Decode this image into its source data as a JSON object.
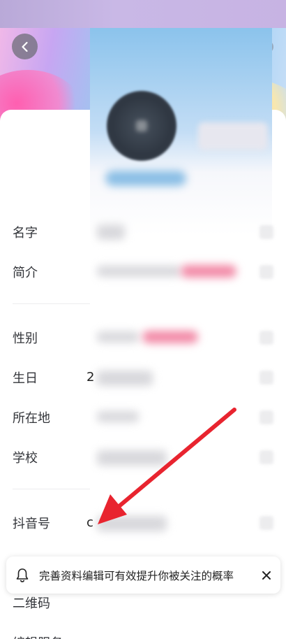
{
  "nav": {
    "back_icon": "chevron-left-icon",
    "more_icon": "more-icon"
  },
  "fields": {
    "name_label": "名字",
    "intro_label": "简介",
    "gender_label": "性别",
    "birthday_label": "生日",
    "location_label": "所在地",
    "school_label": "学校",
    "douyin_id_label": "抖音号",
    "qrcode_label": "二维码",
    "last_row_label": "编辑服务"
  },
  "partial_values": {
    "birthday_first_char": "2",
    "douyin_id_first_char": "c"
  },
  "toast": {
    "icon": "bell-icon",
    "message": "完善资料编辑可有效提升你被关注的概率",
    "close_icon": "close-icon"
  },
  "colors": {
    "annotation_arrow": "#e8242f",
    "toast_text": "#222222"
  }
}
